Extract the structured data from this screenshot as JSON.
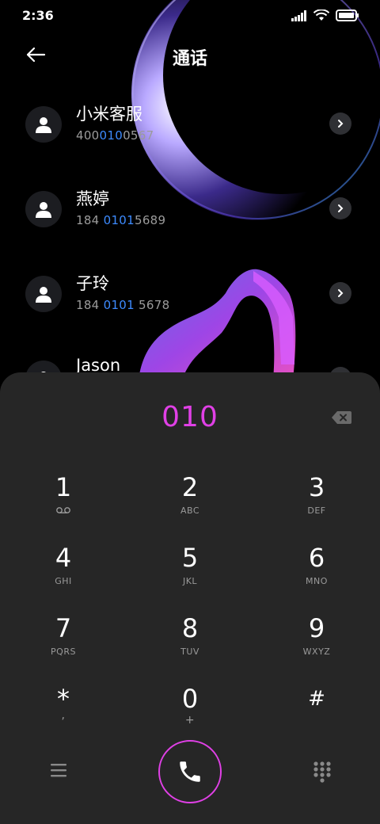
{
  "status": {
    "time": "2:36"
  },
  "header": {
    "title": "通话"
  },
  "contacts": [
    {
      "name": "小米客服",
      "number_pre": "400",
      "number_hl": "010",
      "number_post": "0567"
    },
    {
      "name": "燕婷",
      "number_pre": "184 ",
      "number_hl": "0101",
      "number_post": "5689"
    },
    {
      "name": "子玲",
      "number_pre": "184 ",
      "number_hl": "0101",
      "number_post": " 5678"
    },
    {
      "name": "Jason"
    }
  ],
  "dialer": {
    "input": "010",
    "keys": [
      {
        "digit": "1",
        "letters": ""
      },
      {
        "digit": "2",
        "letters": "ABC"
      },
      {
        "digit": "3",
        "letters": "DEF"
      },
      {
        "digit": "4",
        "letters": "GHI"
      },
      {
        "digit": "5",
        "letters": "JKL"
      },
      {
        "digit": "6",
        "letters": "MNO"
      },
      {
        "digit": "7",
        "letters": "PQRS"
      },
      {
        "digit": "8",
        "letters": "TUV"
      },
      {
        "digit": "9",
        "letters": "WXYZ"
      },
      {
        "digit": "*",
        "letters": ","
      },
      {
        "digit": "0",
        "letters": "+"
      },
      {
        "digit": "#",
        "letters": ""
      }
    ]
  },
  "colors": {
    "accent": "#e040e6",
    "highlight": "#3d8bff",
    "panel": "#262626"
  },
  "icons": [
    "back-arrow-icon",
    "signal-icon",
    "wifi-icon",
    "battery-icon",
    "person-icon",
    "chevron-right-icon",
    "backspace-icon",
    "voicemail-icon",
    "menu-icon",
    "phone-icon",
    "dialpad-icon"
  ]
}
